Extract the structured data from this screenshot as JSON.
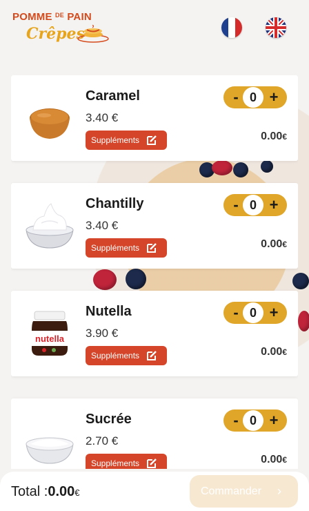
{
  "brand": {
    "line1_a": "POMME",
    "line1_b": "DE",
    "line1_c": "PAIN",
    "line2": "Crêpes"
  },
  "languages": [
    {
      "code": "fr",
      "icon": "france-flag-icon"
    },
    {
      "code": "en",
      "icon": "uk-flag-icon"
    }
  ],
  "products": [
    {
      "name": "Caramel",
      "price": "3.40 €",
      "supplements_label": "Suppléments",
      "qty": "0",
      "line_total": "0.00",
      "currency": "€",
      "image": "caramel-bowl"
    },
    {
      "name": "Chantilly",
      "price": "3.40 €",
      "supplements_label": "Suppléments",
      "qty": "0",
      "line_total": "0.00",
      "currency": "€",
      "image": "whipped-cream-bowl"
    },
    {
      "name": "Nutella",
      "price": "3.90 €",
      "supplements_label": "Suppléments",
      "qty": "0",
      "line_total": "0.00",
      "currency": "€",
      "image": "nutella-jar"
    },
    {
      "name": "Sucrée",
      "price": "2.70 €",
      "supplements_label": "Suppléments",
      "qty": "0",
      "line_total": "0.00",
      "currency": "€",
      "image": "sugar-bowl"
    }
  ],
  "stepper": {
    "minus": "-",
    "plus": "+"
  },
  "footer": {
    "total_label": "Total :",
    "total_value": "0.00",
    "currency": "€",
    "order_label": "Commander"
  },
  "colors": {
    "accent_yellow": "#dfa62a",
    "supplement_red": "#d4452a",
    "order_disabled": "#f7e8d2"
  }
}
